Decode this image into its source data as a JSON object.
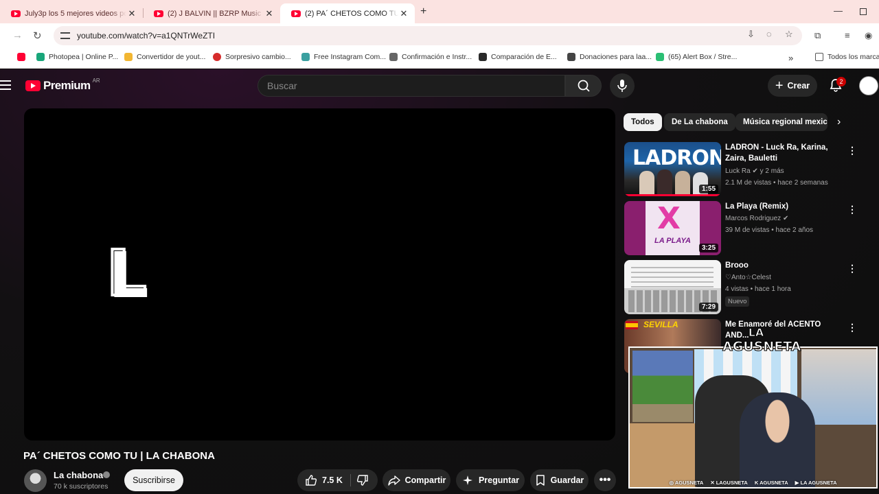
{
  "browser": {
    "tabs": [
      {
        "title": "July3p los 5 mejores videos por",
        "active": false
      },
      {
        "title": "(2) J BALVIN || BZRP Music Sess",
        "active": false
      },
      {
        "title": "(2) PA´ CHETOS COMO TU | LA CH",
        "active": true
      }
    ],
    "url": "youtube.com/watch?v=a1QNTrWeZTI",
    "bookmarks": [
      {
        "label": "Photopea | Online P...",
        "color": "#19a67a"
      },
      {
        "label": "Convertidor de yout...",
        "color": "#f2b632"
      },
      {
        "label": "Sorpresivo cambio...",
        "color": "#d62c2c"
      },
      {
        "label": "Free Instagram Com...",
        "color": "#3aa0a0"
      },
      {
        "label": "Confirmación e Instr...",
        "color": "#666666"
      },
      {
        "label": "Comparación de E...",
        "color": "#2a2a2a"
      },
      {
        "label": "Donaciones para laa...",
        "color": "#444444"
      },
      {
        "label": "(65) Alert Box / Stre...",
        "color": "#2bbf74"
      }
    ],
    "all_bookmarks_label": "Todos los marca"
  },
  "masthead": {
    "logo_text": "Premium",
    "country_code": "AR",
    "search_placeholder": "Buscar",
    "create_label": "Crear",
    "notification_count": "2"
  },
  "video": {
    "player_text": "L",
    "title": "PA´ CHETOS COMO TU | LA CHABONA",
    "channel": "La chabona",
    "subscribers": "70 k suscriptores",
    "subscribe_label": "Suscribirse",
    "likes": "7.5 K",
    "share_label": "Compartir",
    "ask_label": "Preguntar",
    "save_label": "Guardar"
  },
  "chips": [
    "Todos",
    "De La chabona",
    "Música regional mexicana"
  ],
  "recommendations": [
    {
      "title": "LADRON - Luck Ra, Karina, Zaira, Bauletti",
      "channel": "Luck Ra",
      "channel_suffix": "y 2 más",
      "verified": true,
      "stats": "2.1 M de vistas • hace 2 semanas",
      "duration": "1:55",
      "thumb_text": "LADRON",
      "badge": ""
    },
    {
      "title": "La Playa (Remix)",
      "channel": "Marcos Rodriguez",
      "channel_suffix": "",
      "verified": true,
      "stats": "39 M de vistas • hace 2 años",
      "duration": "3:25",
      "thumb_text": "LA PLAYA",
      "badge": ""
    },
    {
      "title": "Brooo",
      "channel": "♡Anto☆Celest",
      "channel_suffix": "",
      "verified": false,
      "stats": "4 vistas • hace 1 hora",
      "duration": "7:29",
      "thumb_text": "",
      "badge": "Nuevo"
    },
    {
      "title": "Me Enamoré del ACENTO AND...",
      "channel": "",
      "channel_suffix": "",
      "verified": false,
      "stats": "",
      "duration": "",
      "thumb_text": "SEVILLA",
      "badge": ""
    }
  ],
  "overlay": {
    "logo_line1": "LA",
    "logo_line2": "AGUSNETA",
    "socials": [
      "AGUSNETA",
      "LAGUSNETA",
      "AGUSNETA",
      "LA AGUSNETA"
    ]
  }
}
